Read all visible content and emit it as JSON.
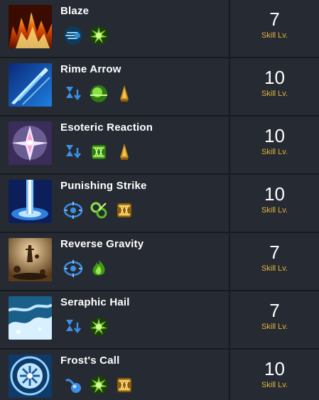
{
  "skills": [
    {
      "name": "Blaze",
      "level": "7",
      "level_label": "Skill Lv.",
      "icon": "fire-blaze-icon",
      "tripods": [
        "wind-dash-icon",
        "green-burst-icon"
      ]
    },
    {
      "name": "Rime Arrow",
      "level": "10",
      "level_label": "Skill Lv.",
      "icon": "ice-arrow-icon",
      "tripods": [
        "blue-hourglass-down-icon",
        "green-orb-icon",
        "gold-spike-icon"
      ]
    },
    {
      "name": "Esoteric Reaction",
      "level": "10",
      "level_label": "Skill Lv.",
      "icon": "crystal-flower-icon",
      "tripods": [
        "blue-hourglass-down-icon",
        "green-fangs-icon",
        "gold-spike-icon"
      ]
    },
    {
      "name": "Punishing Strike",
      "level": "10",
      "level_label": "Skill Lv.",
      "icon": "lightning-pillar-icon",
      "tripods": [
        "blue-target-icon",
        "green-swirl-icon",
        "gold-fangs-icon"
      ]
    },
    {
      "name": "Reverse Gravity",
      "level": "7",
      "level_label": "Skill Lv.",
      "icon": "gravity-rocks-icon",
      "tripods": [
        "blue-target-icon",
        "green-flame-icon"
      ]
    },
    {
      "name": "Seraphic Hail",
      "level": "7",
      "level_label": "Skill Lv.",
      "icon": "hail-storm-icon",
      "tripods": [
        "blue-hourglass-down-icon",
        "green-burst-icon"
      ]
    },
    {
      "name": "Frost's Call",
      "level": "10",
      "level_label": "Skill Lv.",
      "icon": "frost-circle-icon",
      "tripods": [
        "blue-flask-icon",
        "green-burst-icon",
        "gold-fangs-icon"
      ]
    }
  ]
}
